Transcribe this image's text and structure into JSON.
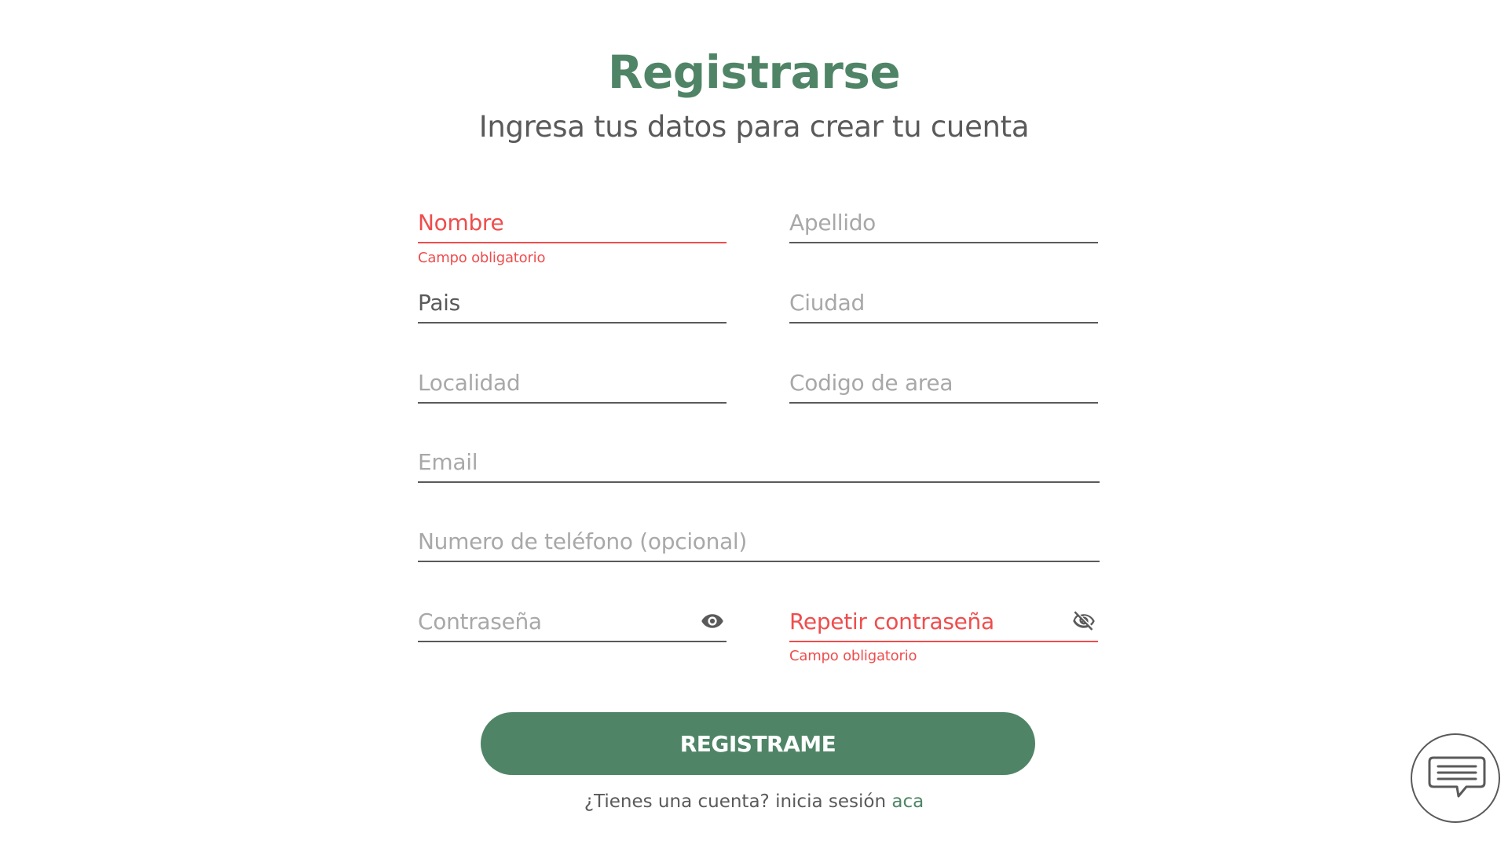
{
  "header": {
    "title": "Registrarse",
    "subtitle": "Ingresa tus datos para crear tu cuenta"
  },
  "form": {
    "nombre": {
      "placeholder": "Nombre",
      "value": "",
      "error": "Campo obligatorio"
    },
    "apellido": {
      "placeholder": "Apellido",
      "value": ""
    },
    "pais": {
      "placeholder": "Pais",
      "value": "Pais"
    },
    "ciudad": {
      "placeholder": "Ciudad",
      "value": ""
    },
    "localidad": {
      "placeholder": "Localidad",
      "value": ""
    },
    "codigo_area": {
      "placeholder": "Codigo de area",
      "value": ""
    },
    "email": {
      "placeholder": "Email",
      "value": ""
    },
    "telefono": {
      "placeholder": "Numero de teléfono (opcional)",
      "value": ""
    },
    "contrasena": {
      "placeholder": "Contraseña",
      "value": "",
      "icon": "eye-icon"
    },
    "repetir_contrasena": {
      "placeholder": "Repetir contraseña",
      "value": "",
      "error": "Campo obligatorio",
      "icon": "eye-off-icon"
    }
  },
  "submit": {
    "label": "REGISTRAME"
  },
  "login": {
    "prompt": "¿Tienes una cuenta? inicia sesión",
    "link": "aca"
  },
  "chat": {
    "icon": "chat-bubble-icon"
  },
  "colors": {
    "accent": "#4f8566",
    "error": "#ef4d4d",
    "text": "#5a5a5a",
    "placeholder": "#a8a8a8"
  }
}
